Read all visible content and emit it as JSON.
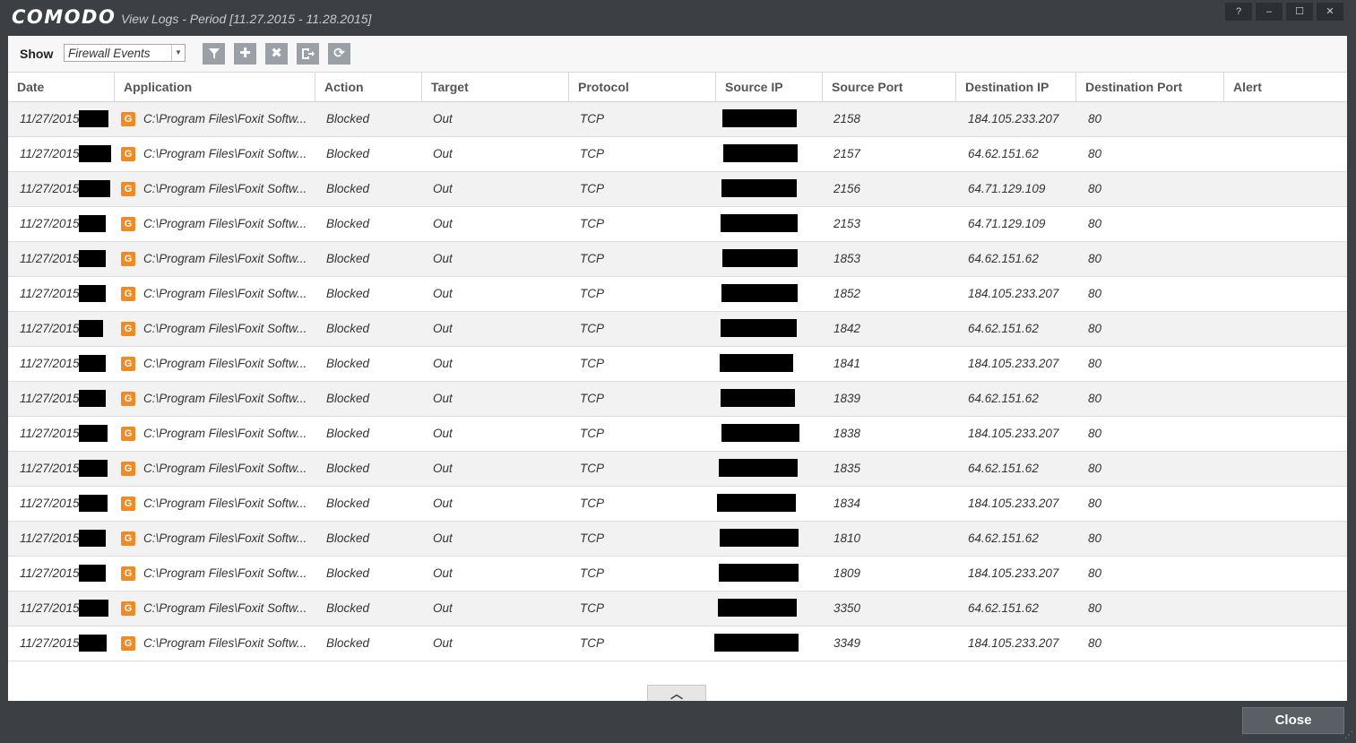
{
  "window": {
    "logo": "COMODO",
    "title": "View Logs - Period [11.27.2015 - 11.28.2015]",
    "buttons": {
      "help": "?",
      "minimize": "–",
      "maximize": "☐",
      "close": "✕"
    }
  },
  "toolbar": {
    "show_label": "Show",
    "show_value": "Firewall Events",
    "icons": [
      "filter-icon",
      "add-icon",
      "delete-icon",
      "export-icon",
      "refresh-icon"
    ]
  },
  "columns": [
    "Date",
    "Application",
    "Action",
    "Target",
    "Protocol",
    "Source IP",
    "Source Port",
    "Destination IP",
    "Destination Port",
    "Alert"
  ],
  "rows": [
    {
      "date": "11/27/2015",
      "app": "C:\\Program Files\\Foxit Softw...",
      "action": "Blocked",
      "target": "Out",
      "protocol": "TCP",
      "src_port": "2158",
      "dst_ip": "184.105.233.207",
      "dst_port": "80",
      "alert": ""
    },
    {
      "date": "11/27/2015",
      "app": "C:\\Program Files\\Foxit Softw...",
      "action": "Blocked",
      "target": "Out",
      "protocol": "TCP",
      "src_port": "2157",
      "dst_ip": "64.62.151.62",
      "dst_port": "80",
      "alert": ""
    },
    {
      "date": "11/27/2015",
      "app": "C:\\Program Files\\Foxit Softw...",
      "action": "Blocked",
      "target": "Out",
      "protocol": "TCP",
      "src_port": "2156",
      "dst_ip": "64.71.129.109",
      "dst_port": "80",
      "alert": ""
    },
    {
      "date": "11/27/2015",
      "app": "C:\\Program Files\\Foxit Softw...",
      "action": "Blocked",
      "target": "Out",
      "protocol": "TCP",
      "src_port": "2153",
      "dst_ip": "64.71.129.109",
      "dst_port": "80",
      "alert": ""
    },
    {
      "date": "11/27/2015",
      "app": "C:\\Program Files\\Foxit Softw...",
      "action": "Blocked",
      "target": "Out",
      "protocol": "TCP",
      "src_port": "1853",
      "dst_ip": "64.62.151.62",
      "dst_port": "80",
      "alert": ""
    },
    {
      "date": "11/27/2015",
      "app": "C:\\Program Files\\Foxit Softw...",
      "action": "Blocked",
      "target": "Out",
      "protocol": "TCP",
      "src_port": "1852",
      "dst_ip": "184.105.233.207",
      "dst_port": "80",
      "alert": ""
    },
    {
      "date": "11/27/2015",
      "app": "C:\\Program Files\\Foxit Softw...",
      "action": "Blocked",
      "target": "Out",
      "protocol": "TCP",
      "src_port": "1842",
      "dst_ip": "64.62.151.62",
      "dst_port": "80",
      "alert": ""
    },
    {
      "date": "11/27/2015",
      "app": "C:\\Program Files\\Foxit Softw...",
      "action": "Blocked",
      "target": "Out",
      "protocol": "TCP",
      "src_port": "1841",
      "dst_ip": "184.105.233.207",
      "dst_port": "80",
      "alert": ""
    },
    {
      "date": "11/27/2015",
      "app": "C:\\Program Files\\Foxit Softw...",
      "action": "Blocked",
      "target": "Out",
      "protocol": "TCP",
      "src_port": "1839",
      "dst_ip": "64.62.151.62",
      "dst_port": "80",
      "alert": ""
    },
    {
      "date": "11/27/2015",
      "app": "C:\\Program Files\\Foxit Softw...",
      "action": "Blocked",
      "target": "Out",
      "protocol": "TCP",
      "src_port": "1838",
      "dst_ip": "184.105.233.207",
      "dst_port": "80",
      "alert": ""
    },
    {
      "date": "11/27/2015",
      "app": "C:\\Program Files\\Foxit Softw...",
      "action": "Blocked",
      "target": "Out",
      "protocol": "TCP",
      "src_port": "1835",
      "dst_ip": "64.62.151.62",
      "dst_port": "80",
      "alert": ""
    },
    {
      "date": "11/27/2015",
      "app": "C:\\Program Files\\Foxit Softw...",
      "action": "Blocked",
      "target": "Out",
      "protocol": "TCP",
      "src_port": "1834",
      "dst_ip": "184.105.233.207",
      "dst_port": "80",
      "alert": ""
    },
    {
      "date": "11/27/2015",
      "app": "C:\\Program Files\\Foxit Softw...",
      "action": "Blocked",
      "target": "Out",
      "protocol": "TCP",
      "src_port": "1810",
      "dst_ip": "64.62.151.62",
      "dst_port": "80",
      "alert": ""
    },
    {
      "date": "11/27/2015",
      "app": "C:\\Program Files\\Foxit Softw...",
      "action": "Blocked",
      "target": "Out",
      "protocol": "TCP",
      "src_port": "1809",
      "dst_ip": "184.105.233.207",
      "dst_port": "80",
      "alert": ""
    },
    {
      "date": "11/27/2015",
      "app": "C:\\Program Files\\Foxit Softw...",
      "action": "Blocked",
      "target": "Out",
      "protocol": "TCP",
      "src_port": "3350",
      "dst_ip": "64.62.151.62",
      "dst_port": "80",
      "alert": ""
    },
    {
      "date": "11/27/2015",
      "app": "C:\\Program Files\\Foxit Softw...",
      "action": "Blocked",
      "target": "Out",
      "protocol": "TCP",
      "src_port": "3349",
      "dst_ip": "184.105.233.207",
      "dst_port": "80",
      "alert": ""
    }
  ],
  "footer": {
    "collapse_glyph": "︿",
    "close_label": "Close"
  },
  "colors": {
    "chrome": "#3c3f44",
    "app_icon": "#f08a24",
    "toolbar_button": "#9aa0a6"
  }
}
